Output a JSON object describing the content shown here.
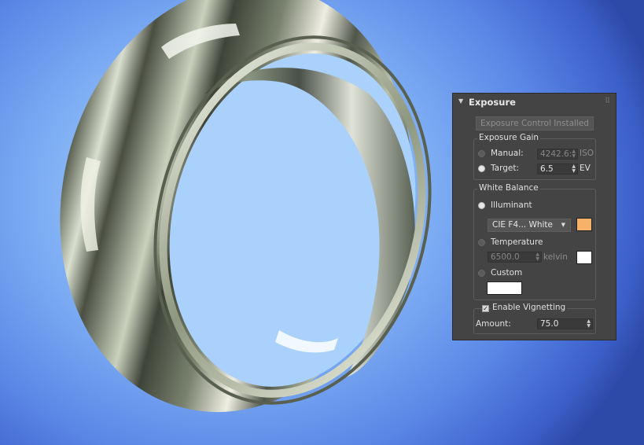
{
  "panel": {
    "title": "Exposure",
    "installed_button": "Exposure Control Installed",
    "exposure_gain": {
      "label": "Exposure Gain",
      "manual": {
        "label": "Manual:",
        "value": "4242.6:",
        "unit": "ISO",
        "selected": false
      },
      "target": {
        "label": "Target:",
        "value": "6.5",
        "unit": "EV",
        "selected": true
      }
    },
    "white_balance": {
      "label": "White Balance",
      "illuminant": {
        "label": "Illuminant",
        "selected": true,
        "preset": "CIE F4... White",
        "swatch_color": "#F7B26A"
      },
      "temperature": {
        "label": "Temperature",
        "selected": false,
        "value": "6500.0",
        "unit": "kelvin",
        "swatch_color": "#FFFFFF"
      },
      "custom": {
        "label": "Custom",
        "selected": false,
        "swatch_color": "#FFFFFF"
      }
    },
    "vignetting": {
      "label": "Enable Vignetting",
      "checked": true,
      "amount_label": "Amount:",
      "amount_value": "75.0"
    }
  },
  "scene": {
    "background_color": "#7BA9F2",
    "object": "metal-ring"
  }
}
